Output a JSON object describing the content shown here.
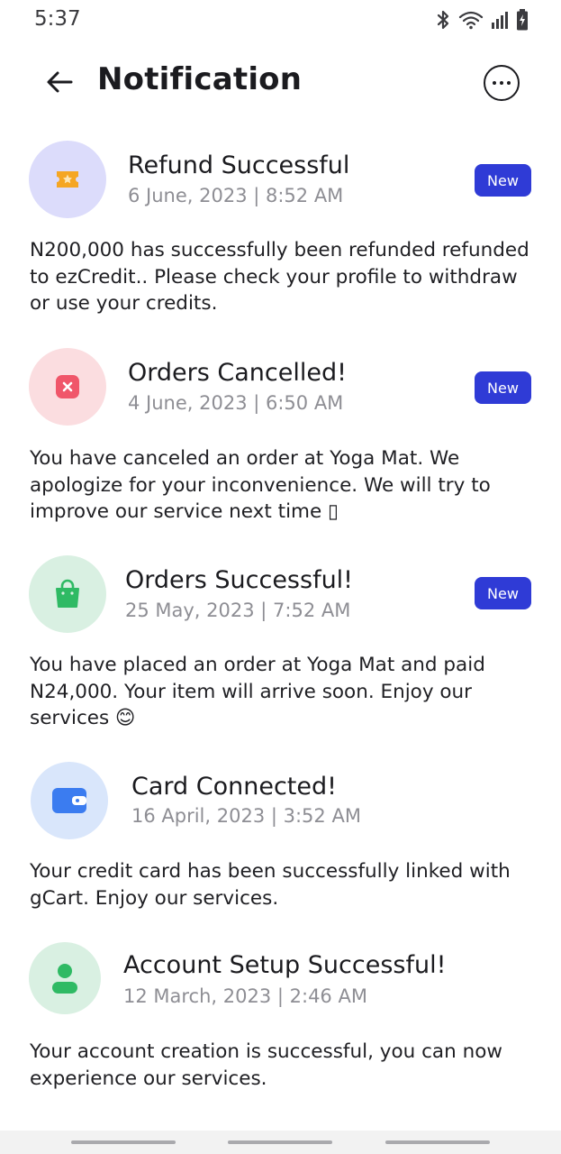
{
  "status_bar": {
    "time": "5:37",
    "icons": [
      "bluetooth-icon",
      "wifi-icon",
      "signal-icon",
      "battery-charging-icon"
    ]
  },
  "header": {
    "title": "Notification",
    "back_icon": "arrow-left-icon",
    "more_icon": "more-horizontal-icon"
  },
  "colors": {
    "badge": "#2f3bd6",
    "refund_bg": "#dcdcfb",
    "refund_fg": "#f5a623",
    "cancel_bg": "#fbdde0",
    "cancel_fg": "#f0566a",
    "order_bg": "#d9f0e2",
    "order_fg": "#2fba64",
    "card_bg": "#d9e6fb",
    "card_fg": "#3b7cf0",
    "account_bg": "#d9f0e2",
    "account_fg": "#2fba64"
  },
  "notifications": [
    {
      "icon": "ticket-icon",
      "title": "Refund Successful",
      "time": "6 June, 2023 | 8:52 AM",
      "badge": "New",
      "body": "N200,000 has successfully been refunded refunded to  ezCredit.. Please check your profile to withdraw or use your credits."
    },
    {
      "icon": "close-square-icon",
      "title": "Orders Cancelled!",
      "time": "4 June, 2023 | 6:50 AM",
      "badge": "New",
      "body": "You have canceled an order at Yoga Mat. We apologize for your inconvenience. We will try to improve our service next time ▯"
    },
    {
      "icon": "shopping-bag-icon",
      "title": "Orders Successful!",
      "time": "25 May, 2023 | 7:52 AM",
      "badge": "New",
      "body": "You have placed an order at Yoga Mat and paid N24,000. Your item will arrive soon. Enjoy our services 😊"
    },
    {
      "icon": "wallet-icon",
      "title": "Card Connected!",
      "time": "16 April, 2023 | 3:52 AM",
      "body": "Your credit card has been successfully linked with gCart. Enjoy our services."
    },
    {
      "icon": "user-icon",
      "title": "Account Setup Successful!",
      "time": "12 March, 2023 | 2:46 AM",
      "body": "Your account creation is successful, you can now experience our services."
    }
  ]
}
